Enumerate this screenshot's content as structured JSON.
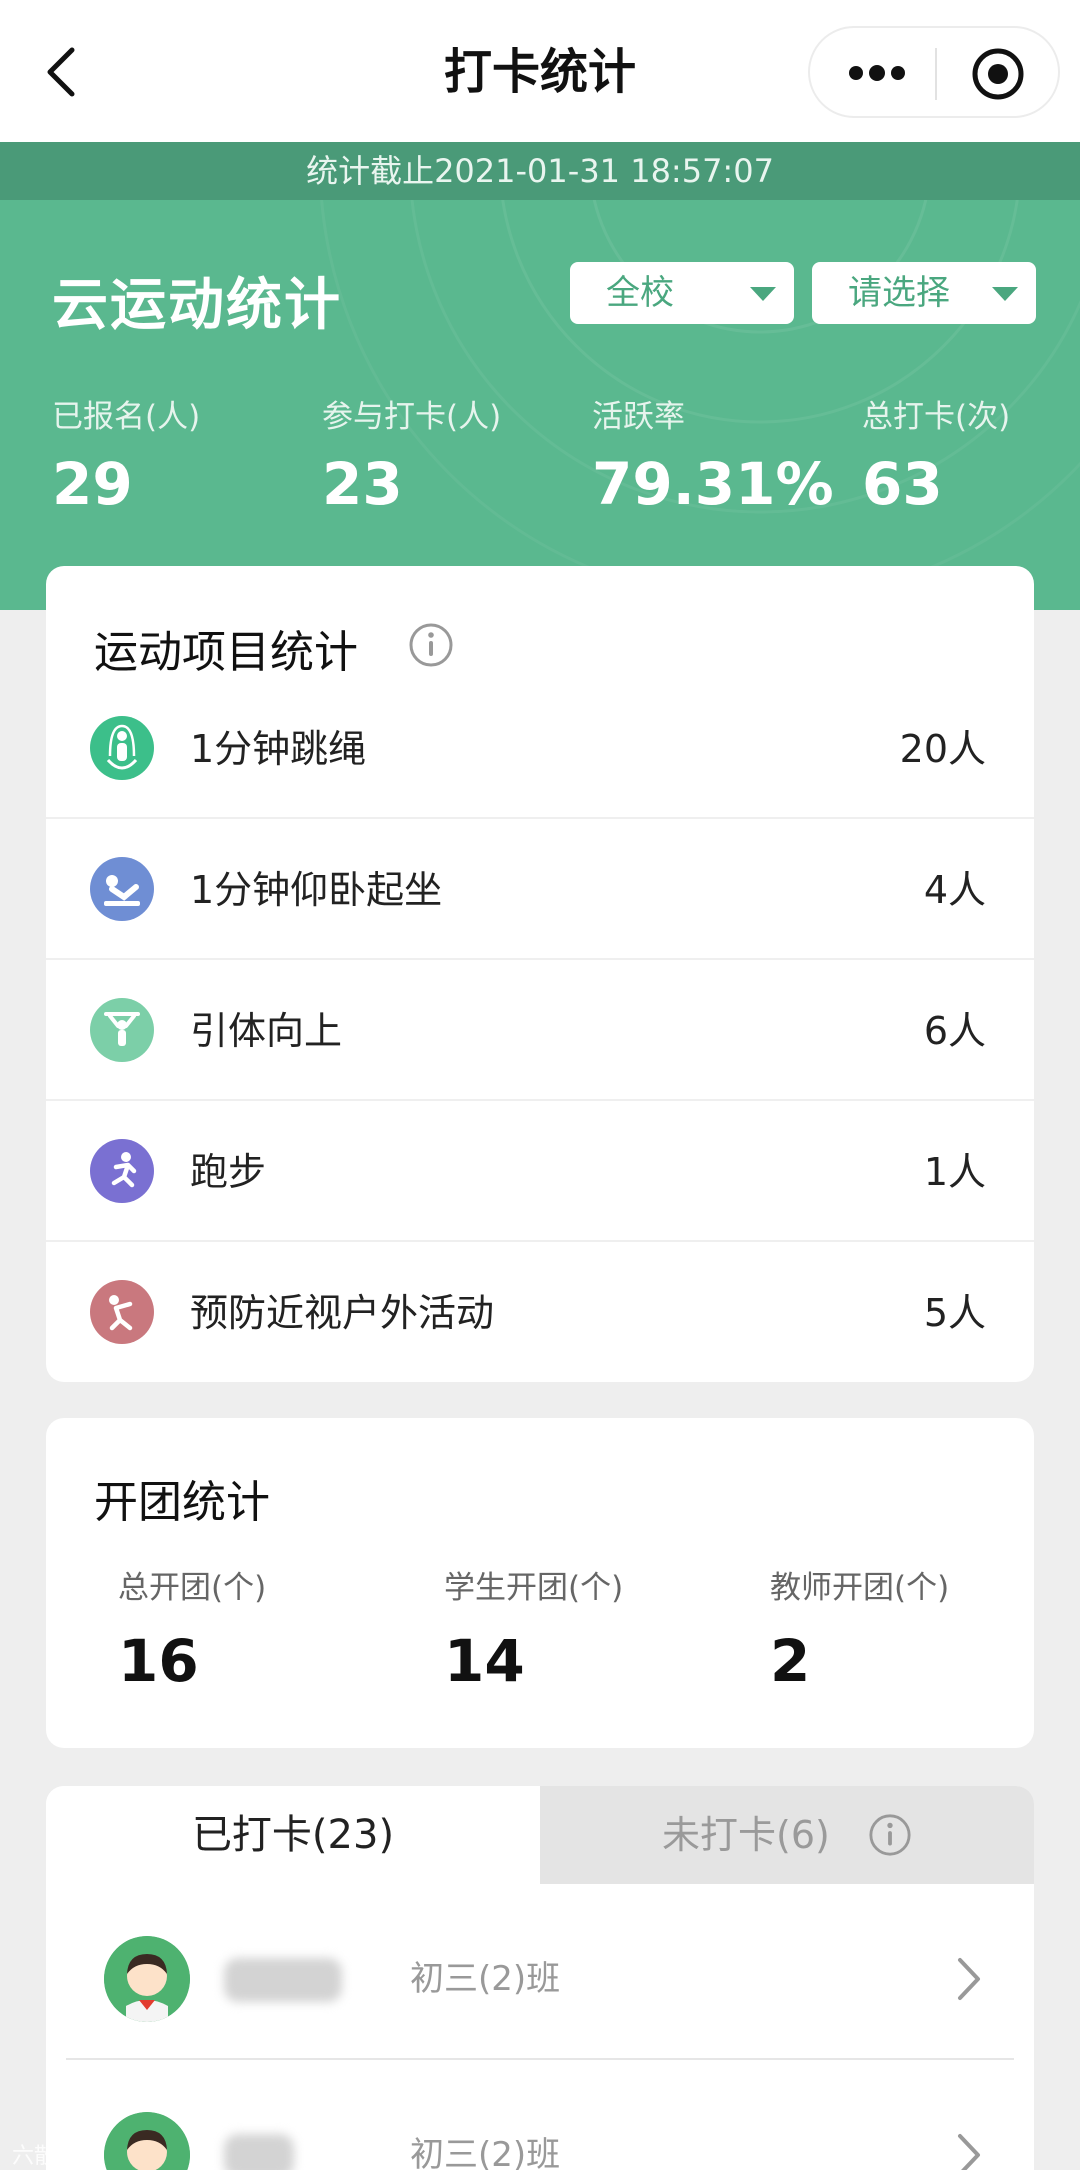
{
  "nav": {
    "title": "打卡统计"
  },
  "hero": {
    "timestamp": "统计截止2021-01-31 18:57:07",
    "title": "云运动统计",
    "filters": [
      {
        "label": "全校"
      },
      {
        "label": "请选择"
      }
    ],
    "stats": [
      {
        "label": "已报名(人)",
        "value": "29"
      },
      {
        "label": "参与打卡(人)",
        "value": "23"
      },
      {
        "label": "活跃率",
        "value": "79.31%"
      },
      {
        "label": "总打卡(次)",
        "value": "63"
      }
    ],
    "bg_color": "#5ab88f",
    "stamp_color": "#4a9a78"
  },
  "sports": {
    "title": "运动项目统计",
    "items": [
      {
        "name": "1分钟跳绳",
        "count": "20人",
        "icon": "rope-skipping-icon",
        "color": "#3cbf8a"
      },
      {
        "name": "1分钟仰卧起坐",
        "count": "4人",
        "icon": "sit-up-icon",
        "color": "#6f8ed4"
      },
      {
        "name": "引体向上",
        "count": "6人",
        "icon": "pull-up-icon",
        "color": "#7ccfa8"
      },
      {
        "name": "跑步",
        "count": "1人",
        "icon": "running-icon",
        "color": "#7a70d2"
      },
      {
        "name": "预防近视户外活动",
        "count": "5人",
        "icon": "outdoor-activity-icon",
        "color": "#c9787e"
      }
    ]
  },
  "groups": {
    "title": "开团统计",
    "stats": [
      {
        "label": "总开团(个)",
        "value": "16"
      },
      {
        "label": "学生开团(个)",
        "value": "14"
      },
      {
        "label": "教师开团(个)",
        "value": "2"
      }
    ]
  },
  "checkin": {
    "tabs": [
      {
        "label": "已打卡(23)"
      },
      {
        "label": "未打卡(6)"
      }
    ],
    "students": [
      {
        "class": "初三(2)班"
      },
      {
        "class": "初三(2)班"
      }
    ]
  },
  "watermark": "六散婚谐"
}
